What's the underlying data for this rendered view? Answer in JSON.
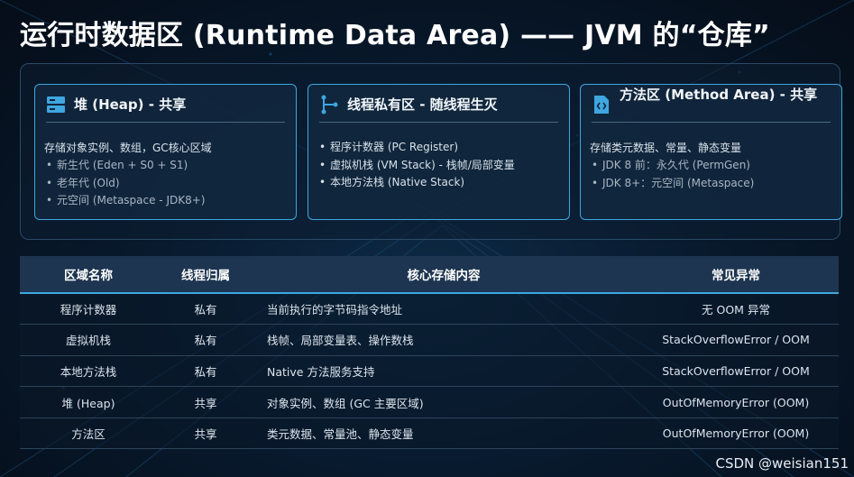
{
  "title": "运行时数据区 (Runtime Data Area) —— JVM 的“仓库”",
  "cards": [
    {
      "icon": "server-icon",
      "title": "堆 (Heap) - 共享",
      "desc": "存储对象实例、数组，GC核心区域",
      "items": [
        "新生代 (Eden + S0 + S1)",
        "老年代 (Old)",
        "元空间 (Metaspace - JDK8+)"
      ]
    },
    {
      "icon": "branch-icon",
      "title": "线程私有区 - 随线程生灭",
      "desc": "",
      "items": [
        "程序计数器 (PC Register)",
        "虚拟机栈 (VM Stack) - 栈帧/局部变量",
        "本地方法栈 (Native Stack)"
      ]
    },
    {
      "icon": "code-file-icon",
      "title": "方法区 (Method Area) - 共享",
      "desc": "存储类元数据、常量、静态变量",
      "items": [
        "JDK 8 前：永久代 (PermGen)",
        "JDK 8+：元空间 (Metaspace)"
      ]
    }
  ],
  "table": {
    "headers": [
      "区域名称",
      "线程归属",
      "核心存储内容",
      "常见异常"
    ],
    "rows": [
      [
        "程序计数器",
        "私有",
        "当前执行的字节码指令地址",
        "无 OOM 异常"
      ],
      [
        "虚拟机栈",
        "私有",
        "栈帧、局部变量表、操作数栈",
        "StackOverflowError / OOM"
      ],
      [
        "本地方法栈",
        "私有",
        "Native 方法服务支持",
        "StackOverflowError / OOM"
      ],
      [
        "堆 (Heap)",
        "共享",
        "对象实例、数组 (GC 主要区域)",
        "OutOfMemoryError (OOM)"
      ],
      [
        "方法区",
        "共享",
        "类元数据、常量池、静态变量",
        "OutOfMemoryError (OOM)"
      ]
    ]
  },
  "colors": {
    "accent": "#3fa6e0",
    "ok": "#2fd08a",
    "error": "#f07070"
  },
  "watermark": "CSDN @weisian151"
}
